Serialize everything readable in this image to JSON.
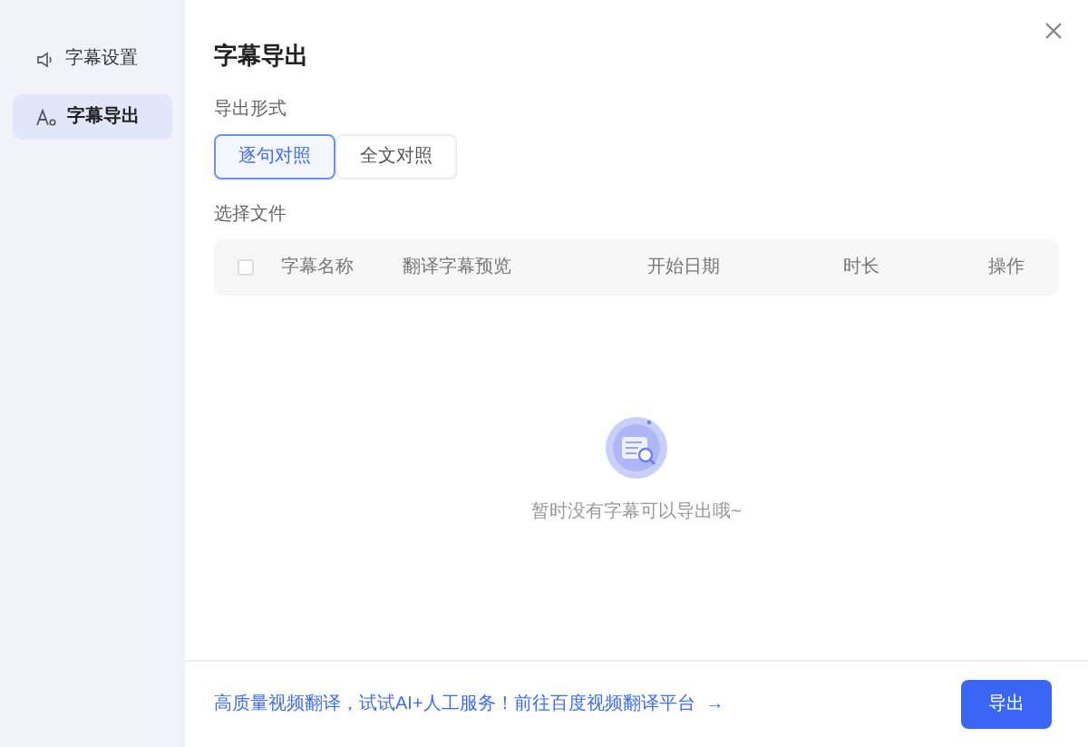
{
  "sidebar": {
    "items": [
      {
        "label": "字幕设置",
        "selected": false
      },
      {
        "label": "字幕导出",
        "selected": true
      }
    ]
  },
  "title": "字幕导出",
  "export_format": {
    "label": "导出形式",
    "options": [
      {
        "label": "逐句对照",
        "selected": true
      },
      {
        "label": "全文对照",
        "selected": false
      }
    ]
  },
  "file_section": {
    "label": "选择文件",
    "select_all_checked": false,
    "columns": [
      "字幕名称",
      "翻译字幕预览",
      "开始日期",
      "时长",
      "操作"
    ]
  },
  "empty_message": "暂时没有字幕可以导出哦~",
  "footer": {
    "link": "高质量视频翻译，试试AI+人工服务！前往百度视频翻译平台",
    "link_arrow": "→",
    "export_button": "导出"
  }
}
